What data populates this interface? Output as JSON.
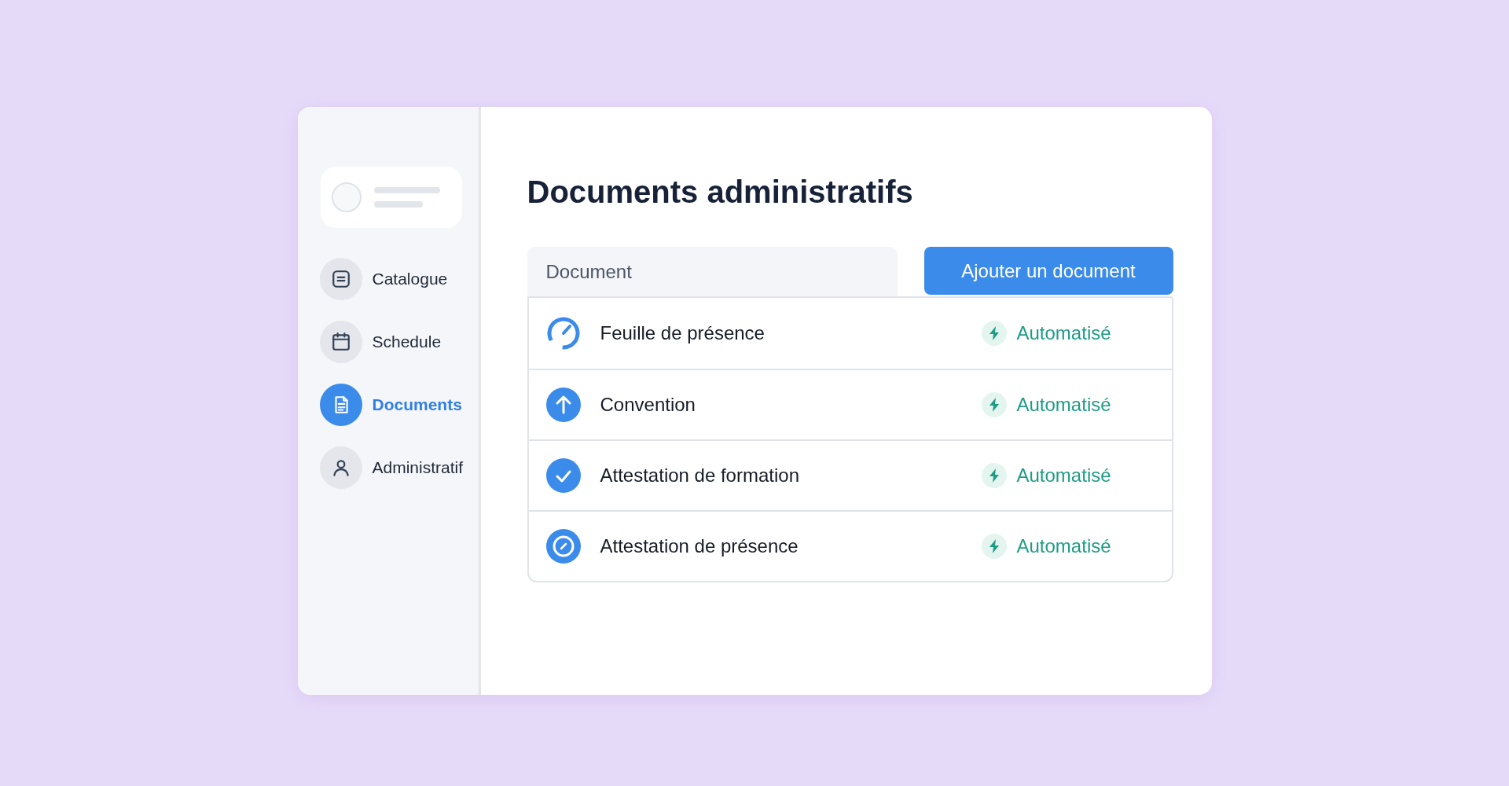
{
  "sidebar": {
    "items": [
      {
        "label": "Catalogue",
        "kind": "list",
        "selected": false
      },
      {
        "label": "Schedule",
        "kind": "calendar",
        "selected": false
      },
      {
        "label": "Documents",
        "kind": "document",
        "selected": true
      },
      {
        "label": "Administratif",
        "kind": "person",
        "selected": false
      }
    ]
  },
  "page": {
    "title": "Documents administratifs"
  },
  "table": {
    "column": "Document",
    "add_button": "Ajouter un document",
    "rows": [
      {
        "name": "Feuille de présence",
        "kind": "gauge",
        "status": "Automatisé"
      },
      {
        "name": "Convention",
        "kind": "upload",
        "status": "Automatisé"
      },
      {
        "name": "Attestation de formation",
        "kind": "check",
        "status": "Automatisé"
      },
      {
        "name": "Attestation de présence",
        "kind": "dial",
        "status": "Automatisé"
      }
    ]
  }
}
